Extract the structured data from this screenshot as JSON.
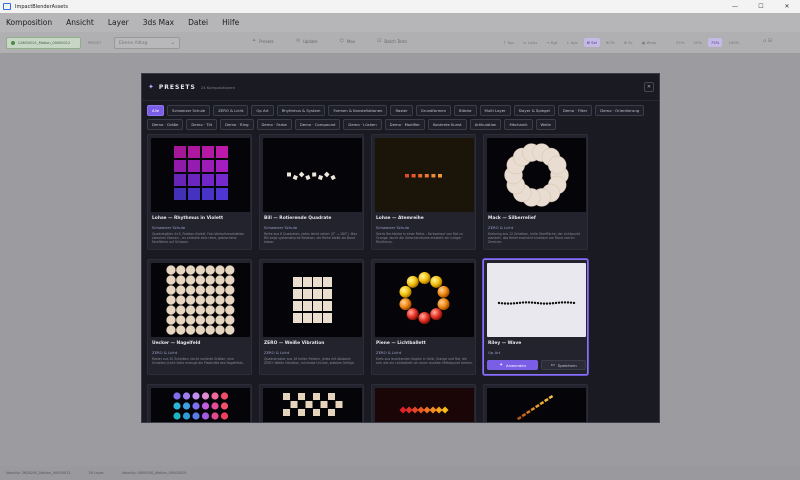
{
  "window": {
    "title": "ImpactBlenderAssets"
  },
  "menu": [
    "Komposition",
    "Ansicht",
    "Layer",
    "3ds Max",
    "Datei",
    "Hilfe"
  ],
  "toolbar": {
    "status": "CAM10021_Motion_00000012",
    "label": "PRESET",
    "select_value": "Ebene Alltag",
    "actions": [
      {
        "icon": "✦",
        "label": "Presets"
      },
      {
        "icon": "⟲",
        "label": "Update"
      },
      {
        "icon": "⌬",
        "label": "Max"
      },
      {
        "icon": "⊡",
        "label": "Batch Tests"
      }
    ],
    "toggles": [
      {
        "label": "↑ Top",
        "on": false
      },
      {
        "label": "▭ Links",
        "on": false
      },
      {
        "label": "→ Rgt",
        "on": false
      },
      {
        "label": "↓ Agc",
        "on": false
      },
      {
        "label": "⊞ Sel",
        "on": true
      },
      {
        "label": "⊕ Fit",
        "on": false
      },
      {
        "label": "⊗ Sc",
        "on": false
      },
      {
        "label": "▣ Wrap",
        "on": false
      }
    ],
    "zoom": [
      {
        "label": "25%",
        "on": false
      },
      {
        "label": "50%",
        "on": false
      },
      {
        "label": "75%",
        "on": true
      },
      {
        "label": "100%",
        "on": false
      },
      {
        "label": "200%",
        "on": false
      }
    ],
    "misc": "⌂ ⊟"
  },
  "statusbar": {
    "left": "Velocity: 260420S_Motion_00000012",
    "mid": "30 Layer",
    "right": "Velocity: 000S00S_Motion_00000019"
  },
  "modal": {
    "title": "PRESETS",
    "count": "24 Kompositionen",
    "filters": [
      "Alle",
      "Schweizer Schule",
      "ZERO & Licht",
      "Op Art",
      "Rhythmus & System",
      "Formen & Konstellationen",
      "Raster",
      "Grundformen",
      "Blöcke",
      "Multi Layer",
      "Slayer & Spiegel",
      "Demo · Filter",
      "Demo · Orientierung",
      "Demo · Größe",
      "Demo · Tilt",
      "Demo · Ring",
      "Demo · Farbe",
      "Demo · Compound",
      "Demo · Lücken",
      "Demo · Modifier",
      "Konkrete Kunst",
      "Artikulation",
      "Mechanik",
      "Welle"
    ],
    "active_filter": 0,
    "cards": [
      {
        "title": "Lohse — Rhythmus in Violett",
        "category": "Schweizer Schule",
        "desc": "Quadratgitter 4×5, Farbton-Violett, Fein-Verlaufsmodulation zwischen Ebenen – es entsteht eine reine, gebrochene Farbfläche auf Schwarz."
      },
      {
        "title": "Bill — Rotierende Quadrate",
        "category": "Schweizer Schule",
        "desc": "Reihe aus 8 Quadraten, jedes leicht rotiert (0° → 180°). Max Bill zeigt systematische Rotation; die Reihe bleibt als Band lesbar."
      },
      {
        "title": "Lohse — Atemreihe",
        "category": "Schweizer Schule",
        "desc": "Sechs Rechtecke in einer Reihe – Farbverlauf von Rot zu Orange; durch die Zwischenräume entsteht ein ruhiger Rhythmus."
      },
      {
        "title": "Mack — Silberrelief",
        "category": "ZERO & Licht",
        "desc": "Kreisring aus 12 Scheiben, helle Oberfläche; der Lichtpunkt wandert, das Relief erscheint kinetisch am Rand und im Zentrum."
      },
      {
        "title": "Uecker — Nagelfeld",
        "category": "ZERO & Licht",
        "desc": "Raster aus 30 Scheiben, leicht variierte Größen; eine Schatten-/Licht-Seite erzeugt die Plastizität des Nagelfelds."
      },
      {
        "title": "ZERO — Weiße Vibration",
        "category": "ZERO & Licht",
        "desc": "Quadratraster aus 16 hellen Feldern, jedes mit Abstand; ZERO: Weiße Vibration, minimale Unruhe, stabiles Gefüge."
      },
      {
        "title": "Piene — Lichtballett",
        "category": "ZERO & Licht",
        "desc": "Kreis aus leuchtenden Kugeln in Gelb, Orange und Rot, die sich wie ein Lichtballett um einen dunklen Mittelpunkt drehen."
      },
      {
        "title": "Riley — Wave",
        "category": "Op Art",
        "desc": ""
      },
      {
        "title": "",
        "category": "",
        "desc": ""
      },
      {
        "title": "",
        "category": "",
        "desc": ""
      },
      {
        "title": "",
        "category": "",
        "desc": ""
      },
      {
        "title": "",
        "category": "",
        "desc": ""
      }
    ],
    "apply_label": "Anwenden",
    "save_label": "Speichern",
    "apply_icon": "wand-icon",
    "save_icon": "save-icon"
  },
  "colors": {
    "accent": "#7b5ee6",
    "background": "#1a1b22",
    "card": "#22232c"
  }
}
